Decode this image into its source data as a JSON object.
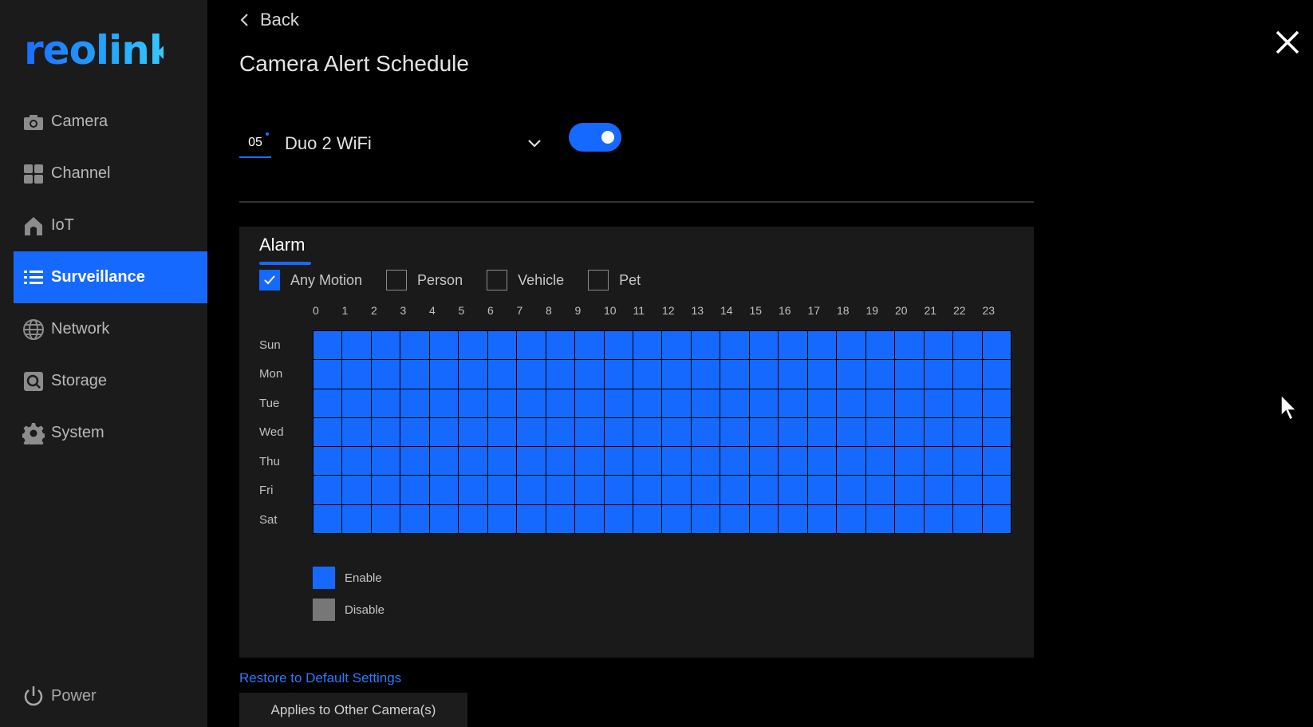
{
  "brand": {
    "logo_text": "reolink",
    "accent_color": "#1569ff"
  },
  "sidebar": {
    "items": [
      {
        "label": "Camera",
        "icon": "camera-icon",
        "active": false
      },
      {
        "label": "Channel",
        "icon": "grid-icon",
        "active": false
      },
      {
        "label": "IoT",
        "icon": "home-icon",
        "active": false
      },
      {
        "label": "Surveillance",
        "icon": "list-icon",
        "active": true
      },
      {
        "label": "Network",
        "icon": "globe-icon",
        "active": false
      },
      {
        "label": "Storage",
        "icon": "storage-icon",
        "active": false
      },
      {
        "label": "System",
        "icon": "gear-icon",
        "active": false
      }
    ],
    "power_label": "Power"
  },
  "header": {
    "back_label": "Back",
    "title": "Camera Alert Schedule"
  },
  "camera_select": {
    "number": "05",
    "name": "Duo 2 WiFi"
  },
  "schedule_enabled": true,
  "alarm": {
    "tab_label": "Alarm",
    "filters": [
      {
        "label": "Any Motion",
        "checked": true
      },
      {
        "label": "Person",
        "checked": false
      },
      {
        "label": "Vehicle",
        "checked": false
      },
      {
        "label": "Pet",
        "checked": false
      }
    ],
    "hours": [
      "0",
      "1",
      "2",
      "3",
      "4",
      "5",
      "6",
      "7",
      "8",
      "9",
      "10",
      "11",
      "12",
      "13",
      "14",
      "15",
      "16",
      "17",
      "18",
      "19",
      "20",
      "21",
      "22",
      "23"
    ],
    "days": [
      "Sun",
      "Mon",
      "Tue",
      "Wed",
      "Thu",
      "Fri",
      "Sat"
    ],
    "schedule": "all-enabled",
    "legend": {
      "enable_label": "Enable",
      "enable_color": "#1569ff",
      "disable_label": "Disable",
      "disable_color": "#777777"
    }
  },
  "footer": {
    "restore_label": "Restore to Default Settings",
    "apply_label": "Applies to Other Camera(s)"
  }
}
